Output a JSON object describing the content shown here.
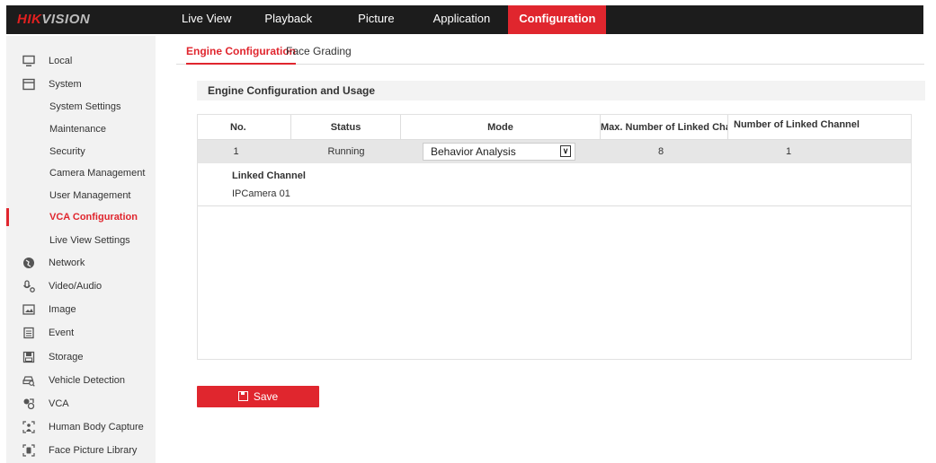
{
  "brand": {
    "part1": "HIK",
    "part2": "VISION"
  },
  "topnav": [
    {
      "label": "Live View",
      "active": false
    },
    {
      "label": "Playback",
      "active": false
    },
    {
      "label": "Picture",
      "active": false
    },
    {
      "label": "Application",
      "active": false
    },
    {
      "label": "Configuration",
      "active": true
    }
  ],
  "sidebar": {
    "local": "Local",
    "system": "System",
    "system_settings": "System Settings",
    "maintenance": "Maintenance",
    "security": "Security",
    "camera_management": "Camera Management",
    "user_management": "User Management",
    "vca_configuration": "VCA Configuration",
    "live_view_settings": "Live View Settings",
    "network": "Network",
    "video_audio": "Video/Audio",
    "image": "Image",
    "event": "Event",
    "storage": "Storage",
    "vehicle_detection": "Vehicle Detection",
    "vca": "VCA",
    "human_body_capture": "Human Body Capture",
    "face_picture_library": "Face Picture Library"
  },
  "tabs": {
    "engine": "Engine Configuration",
    "face_grading": "Face Grading"
  },
  "section_title": "Engine Configuration and Usage",
  "table": {
    "headers": {
      "no": "No.",
      "status": "Status",
      "mode": "Mode",
      "max_linked": "Max. Number of Linked Cha...",
      "num_linked": "Number of Linked Channel"
    },
    "row": {
      "no": "1",
      "status": "Running",
      "mode": "Behavior Analysis",
      "max_linked": "8",
      "num_linked": "1"
    },
    "linked_channel_label": "Linked Channel",
    "linked_channel_value": "IPCamera 01"
  },
  "save_label": "Save",
  "colors": {
    "accent": "#e0262e",
    "topbar": "#1c1c1c",
    "sidebar": "#f2f2f2"
  }
}
